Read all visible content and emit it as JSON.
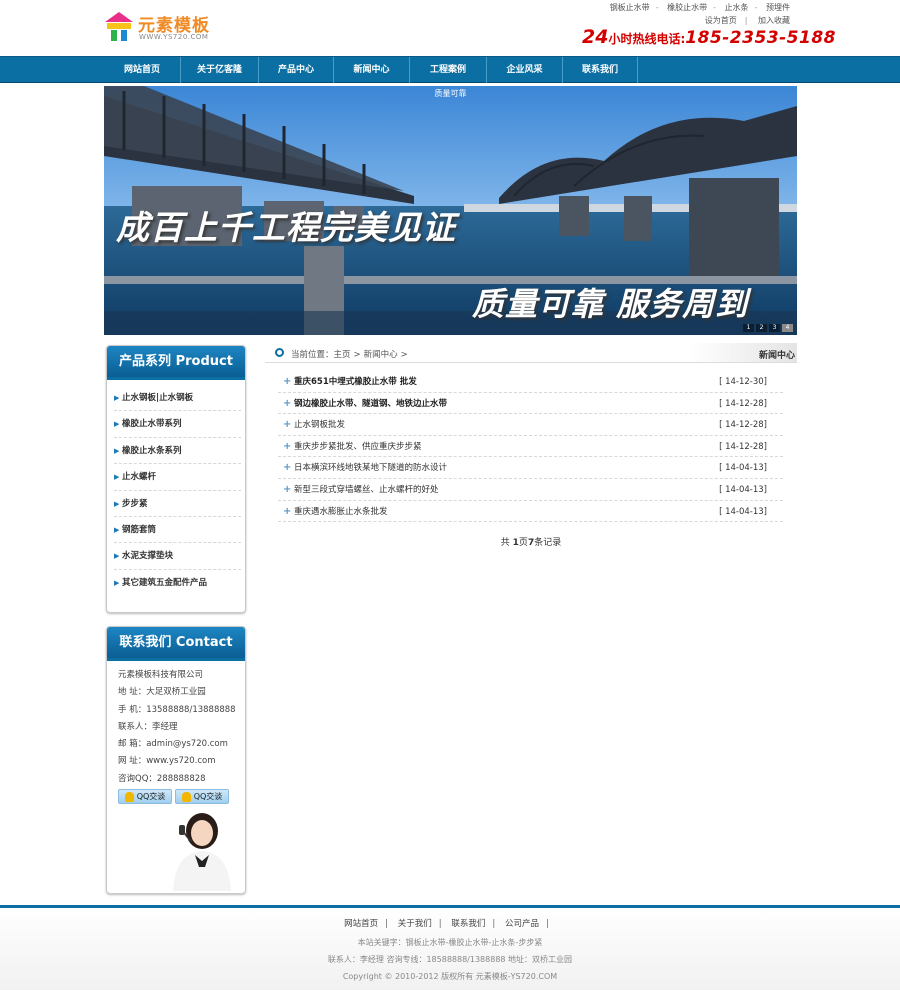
{
  "header": {
    "logo_title": "元素模板",
    "logo_url": "WWW.YS720.COM",
    "top_links": [
      "钢板止水带",
      "橡胶止水带",
      "止水条",
      "预埋件"
    ],
    "top_links2": [
      "设为首页",
      "加入收藏"
    ],
    "hotline_num": "24",
    "hotline_label": "小时热线电话:",
    "hotline_phone": "185-2353-5188"
  },
  "nav": {
    "items": [
      "网站首页",
      "关于亿客隆",
      "产品中心",
      "新闻中心",
      "工程案例",
      "企业风采",
      "联系我们"
    ]
  },
  "banner": {
    "caption": "质量可靠",
    "slogan1": "成百上千工程完美见证",
    "slogan2": "质量可靠 服务周到",
    "dots": [
      "1",
      "2",
      "3",
      "4"
    ]
  },
  "products": {
    "title": "产品系列 Product",
    "items": [
      "止水钢板|止水钢板",
      "橡胶止水带系列",
      "橡胶止水条系列",
      "止水螺杆",
      "步步紧",
      "钢筋套筒",
      "水泥支撑垫块",
      "其它建筑五金配件产品"
    ]
  },
  "contact": {
    "title": "联系我们 Contact",
    "lines": [
      "元素模板科技有限公司",
      "地 址：大足双桥工业园",
      "手 机：13588888/13888888",
      "联系人：李经理",
      "邮 箱：admin@ys720.com",
      "网 址：www.ys720.com",
      "咨询QQ：288888828"
    ],
    "qq_buttons": [
      "QQ交谈",
      "QQ交谈"
    ]
  },
  "main": {
    "crumb_label": "当前位置：",
    "crumb_home": "主页",
    "crumb_current": "新闻中心",
    "crumb_sep": ">",
    "section_title": "新闻中心",
    "news": [
      {
        "title": "重庆651中埋式橡胶止水带 批发",
        "date": "[ 14-12-30]"
      },
      {
        "title": "钢边橡胶止水带、隧道钢、地铁边止水带",
        "date": "[ 14-12-28]"
      },
      {
        "title": "止水钢板批发",
        "date": "[ 14-12-28]"
      },
      {
        "title": "重庆步步紧批发、供应重庆步步紧",
        "date": "[ 14-12-28]"
      },
      {
        "title": "日本横滨环线地铁某地下隧道的防水设计",
        "date": "[ 14-04-13]"
      },
      {
        "title": "新型三段式穿墙螺丝、止水螺杆的好处",
        "date": "[ 14-04-13]"
      },
      {
        "title": "重庆遇水膨胀止水条批发",
        "date": "[ 14-04-13]"
      }
    ],
    "pager_pre": "共 ",
    "pager_pages": "1",
    "pager_mid": "页",
    "pager_count": "7",
    "pager_post": "条记录"
  },
  "footer": {
    "links": [
      "网站首页",
      "关于我们",
      "联系我们",
      "公司产品"
    ],
    "keywords": "本站关键字：钢板止水带-橡胶止水带-止水条-步步紧",
    "contact": "联系人：李经理 咨询专线：18588888/1388888 地址：双桥工业园",
    "copyright": "Copyright © 2010-2012 版权所有 元素模板-YS720.COM"
  }
}
